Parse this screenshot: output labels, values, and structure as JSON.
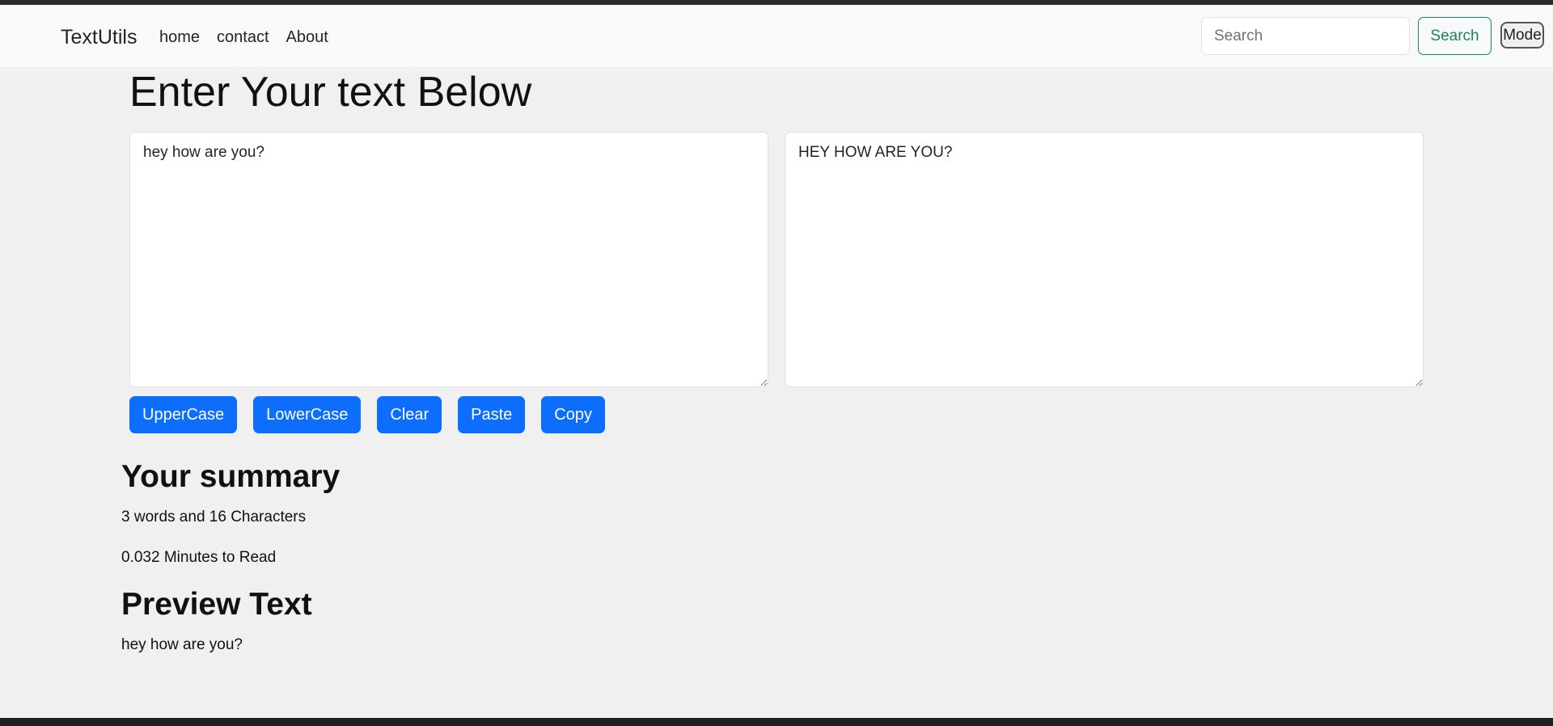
{
  "navbar": {
    "brand": "TextUtils",
    "links": [
      {
        "label": "home"
      },
      {
        "label": "contact"
      },
      {
        "label": "About"
      }
    ],
    "search": {
      "placeholder": "Search",
      "value": ""
    },
    "search_button_label": "Search",
    "mode_button_label": "Mode"
  },
  "main": {
    "title": "Enter Your text Below",
    "input_text": "hey how are you?",
    "output_text": "HEY HOW ARE YOU?",
    "buttons": [
      {
        "label": "UpperCase"
      },
      {
        "label": "LowerCase"
      },
      {
        "label": "Clear"
      },
      {
        "label": "Paste"
      },
      {
        "label": "Copy"
      }
    ]
  },
  "summary": {
    "title": "Your summary",
    "words_line": "3 words and 16 Characters",
    "minutes_line": "0.032 Minutes to Read"
  },
  "preview": {
    "title": "Preview Text",
    "text": "hey how are you?"
  },
  "colors": {
    "primary": "#0d6efd",
    "success": "#198754",
    "background": "#f0f0f0",
    "navbar": "#f8f9fa"
  }
}
